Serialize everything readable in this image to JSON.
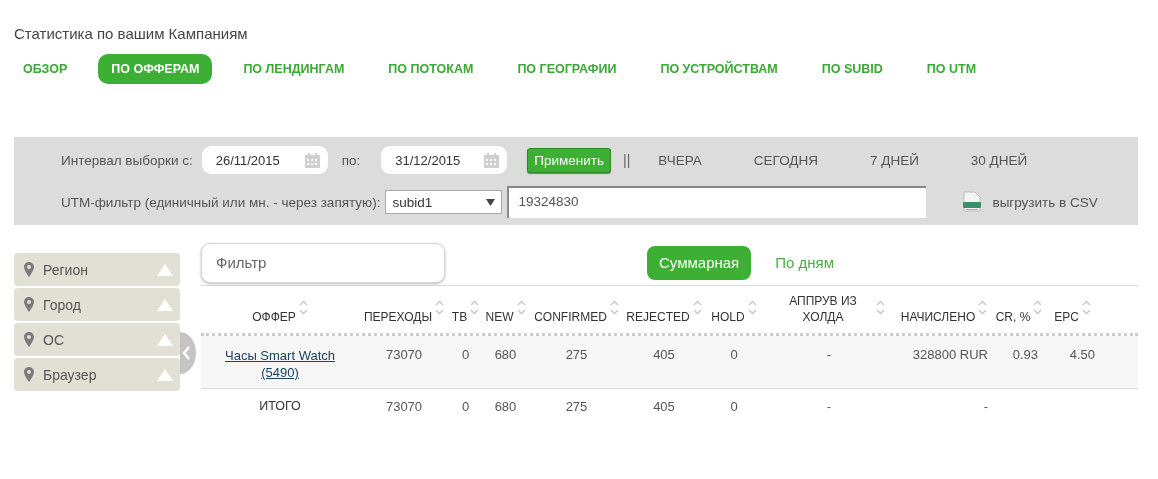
{
  "title": "Статистика по вашим Кампаниям",
  "tabs": [
    {
      "label": "ОБЗОР",
      "selected": false
    },
    {
      "label": "ПО ОФФЕРАМ",
      "selected": true
    },
    {
      "label": "ПО ЛЕНДИНГАМ",
      "selected": false
    },
    {
      "label": "ПО ПОТОКАМ",
      "selected": false
    },
    {
      "label": "ПО ГЕОГРАФИИ",
      "selected": false
    },
    {
      "label": "ПО УСТРОЙСТВАМ",
      "selected": false
    },
    {
      "label": "ПО SUBID",
      "selected": false
    },
    {
      "label": "ПО UTM",
      "selected": false
    }
  ],
  "filter_panel": {
    "interval_label": "Интервал выборки с:",
    "date_from": "26/11/2015",
    "to_label": "по:",
    "date_to": "31/12/2015",
    "apply_button": "Применить",
    "separator": "||",
    "quick_ranges": [
      "ВЧЕРА",
      "СЕГОДНЯ",
      "7 ДНЕЙ",
      "30 ДНЕЙ"
    ],
    "utm_label": "UTM-фильтр (единичный или мн. - через запятую):",
    "utm_select": "subid1",
    "utm_value": "19324830",
    "export_link": "выгрузить в CSV"
  },
  "sidebar": {
    "items": [
      {
        "label": "Регион"
      },
      {
        "label": "Город"
      },
      {
        "label": "ОС"
      },
      {
        "label": "Браузер"
      }
    ]
  },
  "filter_field": {
    "placeholder": "Фильтр"
  },
  "view_toggle": [
    {
      "label": "Суммарная",
      "selected": true
    },
    {
      "label": "По дням",
      "selected": false
    }
  ],
  "table": {
    "columns": [
      "ОФФЕР",
      "ПЕРЕХОДЫ",
      "ТВ",
      "NEW",
      "CONFIRMED",
      "REJECTED",
      "HOLD",
      "АППРУВ ИЗ ХОЛДА",
      "НАЧИСЛЕНО",
      "CR, %",
      "EPC"
    ],
    "rows": [
      {
        "cells": [
          "Часы Smart Watch (5490)",
          "73070",
          "0",
          "680",
          "275",
          "405",
          "0",
          "-",
          "328800 RUR",
          "0.93",
          "4.50"
        ]
      }
    ],
    "total": {
      "cells": [
        "ИТОГО",
        "73070",
        "0",
        "680",
        "275",
        "405",
        "0",
        "-",
        "-"
      ]
    }
  }
}
